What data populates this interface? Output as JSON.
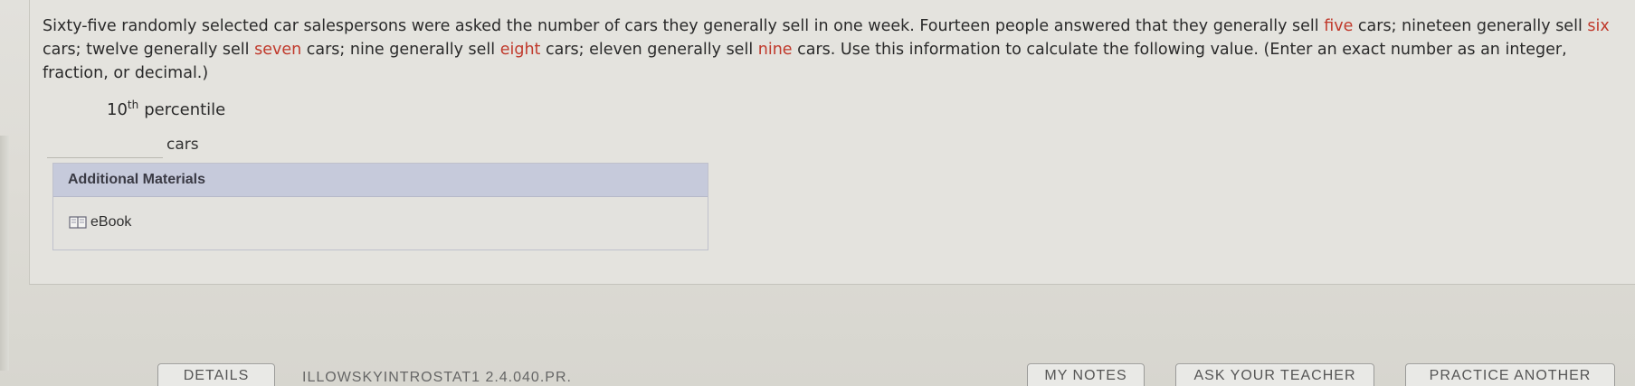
{
  "question": {
    "prompt_parts": [
      {
        "text": "Sixty-five randomly selected car salespersons were asked the number of cars they generally sell in one week. Fourteen people answered that they generally sell ",
        "highlight": false
      },
      {
        "text": "five",
        "highlight": true
      },
      {
        "text": " cars; nineteen generally sell ",
        "highlight": false
      },
      {
        "text": "six",
        "highlight": true
      },
      {
        "text": " cars; twelve generally sell ",
        "highlight": false
      },
      {
        "text": "seven",
        "highlight": true
      },
      {
        "text": " cars; nine generally sell ",
        "highlight": false
      },
      {
        "text": "eight",
        "highlight": true
      },
      {
        "text": " cars; eleven generally sell ",
        "highlight": false
      },
      {
        "text": "nine",
        "highlight": true
      },
      {
        "text": " cars. Use this information to calculate the following value. (Enter an exact number as an integer, fraction, or decimal.)",
        "highlight": false
      }
    ],
    "answer_label_number": "10",
    "answer_label_suffix": "th",
    "answer_label_text": "percentile",
    "answer_value": "",
    "answer_unit": "cars"
  },
  "materials": {
    "header": "Additional Materials",
    "ebook_label": "eBook"
  },
  "footer": {
    "details_label": "DETAILS",
    "assignment_code": "ILLOWSKYINTROSTAT1 2.4.040.PR.",
    "my_notes_label": "MY NOTES",
    "ask_teacher_label": "ASK YOUR TEACHER",
    "practice_label": "PRACTICE ANOTHER"
  },
  "colors": {
    "highlight": "#c0392b",
    "materials_header_bg": "#c6cadb"
  },
  "icons": {
    "ebook": "book-icon"
  }
}
